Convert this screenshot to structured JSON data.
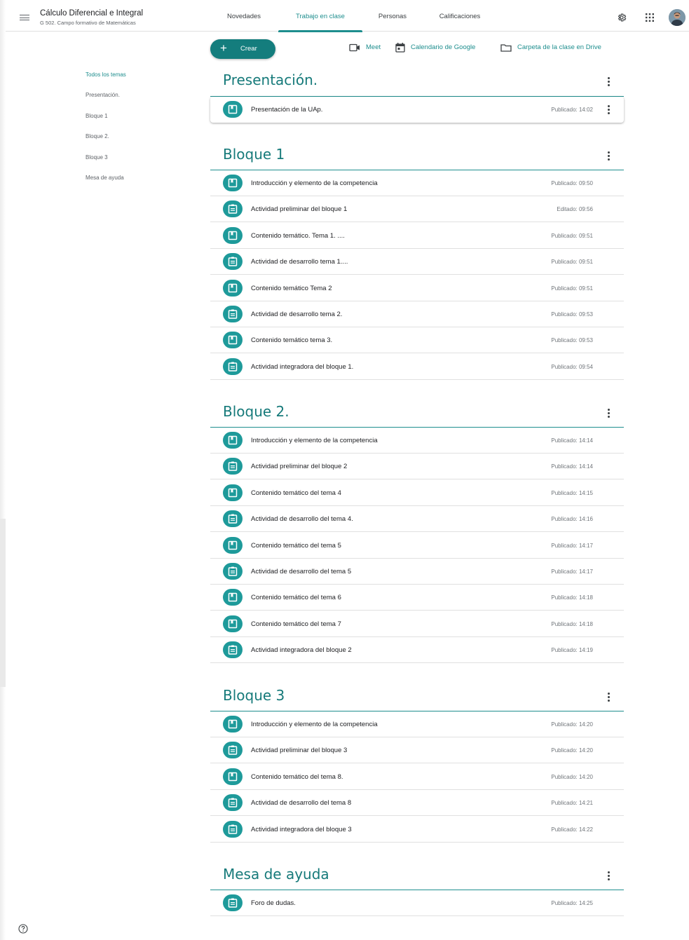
{
  "header": {
    "class_name": "Cálculo Diferencial e Integral",
    "class_section": "G 502. Campo formativo de Matemáticas",
    "tabs": [
      {
        "label": "Novedades"
      },
      {
        "label": "Trabajo en clase",
        "active": true
      },
      {
        "label": "Personas"
      },
      {
        "label": "Calificaciones"
      }
    ],
    "icons": [
      "menu-icon",
      "gear-icon",
      "apps-icon",
      "avatar"
    ]
  },
  "actions": {
    "create_label": "Crear",
    "meet_label": "Meet",
    "calendar_label": "Calendario de Google",
    "drive_label": "Carpeta de la clase en Drive"
  },
  "topic_nav": [
    {
      "label": "Todos los temas",
      "active": true
    },
    {
      "label": "Presentación."
    },
    {
      "label": "Bloque 1"
    },
    {
      "label": "Bloque 2."
    },
    {
      "label": "Bloque 3"
    },
    {
      "label": "Mesa de ayuda"
    }
  ],
  "sections": [
    {
      "title": "Presentación.",
      "items": [
        {
          "title": "Presentación de la UAp.",
          "status": "Publicado: 14:02",
          "icon": "material-icon"
        }
      ]
    },
    {
      "title": "Bloque 1",
      "items": [
        {
          "title": "Introducción y elemento de la competencia",
          "status": "Publicado: 09:50",
          "icon": "material-icon"
        },
        {
          "title": "Actividad preliminar del bloque 1",
          "status": "Editado: 09:56",
          "icon": "assignment-icon"
        },
        {
          "title": "Contenido temático. Tema 1. ....",
          "status": "Publicado: 09:51",
          "icon": "material-icon"
        },
        {
          "title": "Actividad de desarrollo tema 1....",
          "status": "Publicado: 09:51",
          "icon": "assignment-icon"
        },
        {
          "title": "Contenido temático Tema 2",
          "status": "Publicado: 09:51",
          "icon": "material-icon"
        },
        {
          "title": "Actividad de desarrollo tema 2.",
          "status": "Publicado: 09:53",
          "icon": "assignment-icon"
        },
        {
          "title": "Contenido temático tema 3.",
          "status": "Publicado: 09:53",
          "icon": "material-icon"
        },
        {
          "title": "Actividad integradora del bloque 1.",
          "status": "Publicado: 09:54",
          "icon": "assignment-icon"
        }
      ]
    },
    {
      "title": "Bloque 2.",
      "items": [
        {
          "title": "Introducción y elemento de la competencia",
          "status": "Publicado: 14:14",
          "icon": "material-icon"
        },
        {
          "title": "Actividad preliminar del bloque 2",
          "status": "Publicado: 14:14",
          "icon": "assignment-icon"
        },
        {
          "title": "Contenido temático del tema 4",
          "status": "Publicado: 14:15",
          "icon": "material-icon"
        },
        {
          "title": "Actividad de desarrollo del tema 4.",
          "status": "Publicado: 14:16",
          "icon": "assignment-icon"
        },
        {
          "title": "Contenido temático del tema 5",
          "status": "Publicado: 14:17",
          "icon": "material-icon"
        },
        {
          "title": "Actividad de desarrollo del tema 5",
          "status": "Publicado: 14:17",
          "icon": "assignment-icon"
        },
        {
          "title": "Contenido temático del tema 6",
          "status": "Publicado: 14:18",
          "icon": "material-icon"
        },
        {
          "title": "Contenido temático del tema 7",
          "status": "Publicado: 14:18",
          "icon": "material-icon"
        },
        {
          "title": "Actividad integradora del bloque 2",
          "status": "Publicado: 14:19",
          "icon": "assignment-icon"
        }
      ]
    },
    {
      "title": "Bloque 3",
      "items": [
        {
          "title": "Introducción y elemento de la competencia",
          "status": "Publicado: 14:20",
          "icon": "material-icon"
        },
        {
          "title": "Actividad preliminar del bloque 3",
          "status": "Publicado: 14:20",
          "icon": "assignment-icon"
        },
        {
          "title": "Contenido temático del tema 8.",
          "status": "Publicado: 14:20",
          "icon": "material-icon"
        },
        {
          "title": "Actividad de desarrollo del tema 8",
          "status": "Publicado: 14:21",
          "icon": "assignment-icon"
        },
        {
          "title": "Actividad integradora del bloque 3",
          "status": "Publicado: 14:22",
          "icon": "assignment-icon"
        }
      ]
    },
    {
      "title": "Mesa de ayuda",
      "items": [
        {
          "title": "Foro de dudas.",
          "status": "Publicado: 14:25",
          "icon": "question-icon"
        }
      ]
    }
  ],
  "colors": {
    "accent": "#1e8e8e",
    "create_button": "#147d7d",
    "item_icon_bg": "#1e9a9a"
  }
}
